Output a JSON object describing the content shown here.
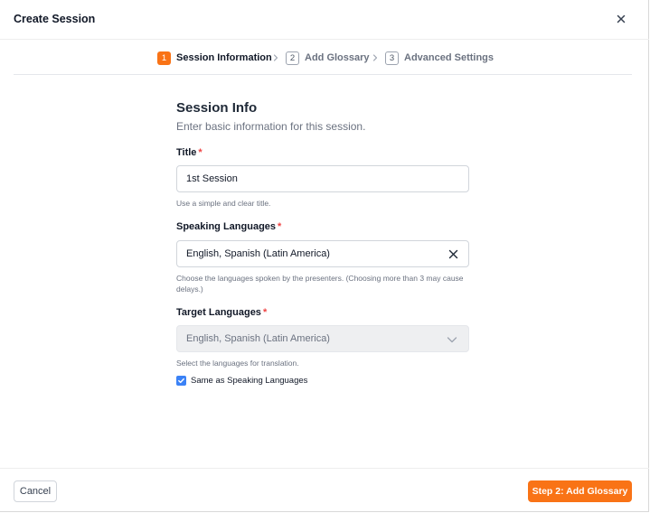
{
  "modal": {
    "title": "Create Session",
    "close_icon": "close-icon"
  },
  "stepper": {
    "steps": [
      {
        "number": "1",
        "label": "Session Information",
        "state": "active"
      },
      {
        "number": "2",
        "label": "Add Glossary",
        "state": "inactive"
      },
      {
        "number": "3",
        "label": "Advanced Settings",
        "state": "inactive"
      }
    ],
    "separator_icon": "chevron-right-icon"
  },
  "form": {
    "heading": "Session Info",
    "subheading": "Enter basic information for this session.",
    "title_field": {
      "label": "Title",
      "required_mark": "*",
      "value": "1st Session",
      "help": "Use a simple and clear title."
    },
    "speaking_languages": {
      "label": "Speaking Languages",
      "required_mark": "*",
      "value": "English, Spanish (Latin America)",
      "clear_icon": "clear-icon",
      "help": "Choose the languages spoken by the presenters. (Choosing more than 3 may cause delays.)"
    },
    "target_languages": {
      "label": "Target Languages",
      "required_mark": "*",
      "value": "English, Spanish (Latin America)",
      "disabled": true,
      "dropdown_icon": "chevron-down-icon",
      "help": "Select the languages for translation."
    },
    "same_as_speaking": {
      "label": "Same as Speaking Languages",
      "checked": true
    }
  },
  "footer": {
    "cancel_label": "Cancel",
    "next_label": "Step 2: Add Glossary"
  },
  "colors": {
    "accent": "#f97316",
    "checkbox": "#3b82f6",
    "required": "#ef4444"
  }
}
